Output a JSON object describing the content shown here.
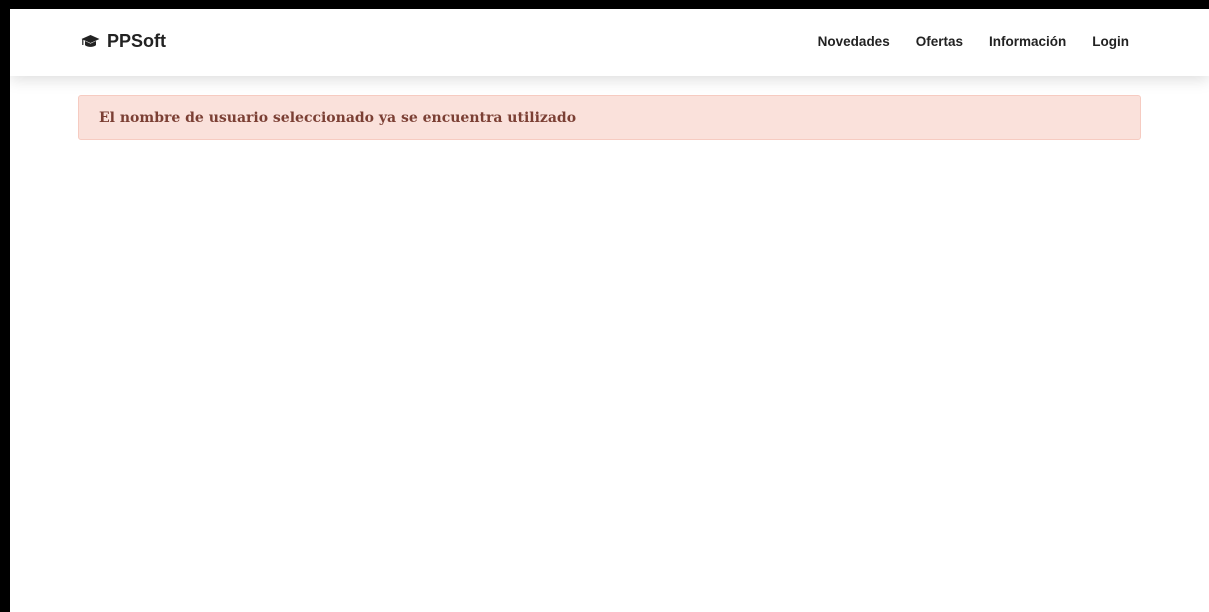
{
  "brand": {
    "name": "PPSoft",
    "icon": "graduation-cap-icon"
  },
  "nav": {
    "items": [
      {
        "label": "Novedades"
      },
      {
        "label": "Ofertas"
      },
      {
        "label": "Información"
      },
      {
        "label": "Login"
      }
    ]
  },
  "alert": {
    "message": "El nombre de usuario seleccionado ya se encuentra utilizado",
    "background_color": "#fae1db",
    "text_color": "#7b3f34"
  }
}
